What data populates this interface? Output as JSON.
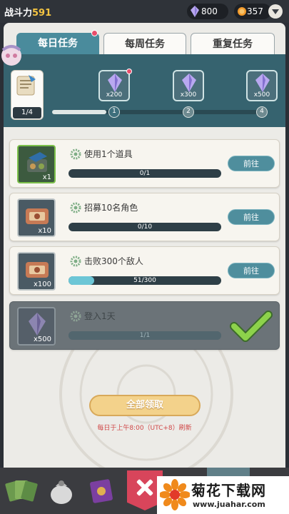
{
  "topbar": {
    "power_label": "战斗力",
    "power_value": "591",
    "crystals": "800",
    "coins": "357"
  },
  "tabs": [
    {
      "label": "每日任务",
      "active": true
    },
    {
      "label": "每周任务",
      "active": false
    },
    {
      "label": "重复任务",
      "active": false
    }
  ],
  "progress": {
    "count_text": "1/4",
    "fraction": 0.25,
    "milestones": [
      {
        "qty": "x200",
        "node": "1",
        "icon": "crystal-icon"
      },
      {
        "qty": "x300",
        "node": "2",
        "icon": "crystal-icon"
      },
      {
        "qty": "x500",
        "node": "3",
        "icon": "crystal-icon"
      }
    ],
    "last_node": "4"
  },
  "tasks": [
    {
      "title": "使用1个道具",
      "progress_text": "0/1",
      "progress": 0.0,
      "reward_qty": "x1",
      "reward_icon": "supply-crate-icon",
      "button": "前往"
    },
    {
      "title": "招募10名角色",
      "progress_text": "0/10",
      "progress": 0.0,
      "reward_qty": "x10",
      "reward_icon": "recruit-ticket-icon",
      "button": "前往"
    },
    {
      "title": "击败300个敌人",
      "progress_text": "51/300",
      "progress": 0.17,
      "reward_qty": "x100",
      "reward_icon": "recruit-ticket-icon",
      "button": "前往"
    },
    {
      "title": "登入1天",
      "progress_text": "1/1",
      "progress": 1.0,
      "reward_qty": "x500",
      "reward_icon": "crystal-icon",
      "completed": true
    }
  ],
  "claim_all_label": "全部领取",
  "refresh_note": "每日于上午8:00（UTC+8）刷新",
  "watermark": {
    "title": "菊花下载网",
    "url": "www.juahar.com"
  },
  "colors": {
    "accent": "#4a8b9c",
    "header": "#36636f",
    "alert": "#e94d6b",
    "claim": "#f3d28b"
  }
}
